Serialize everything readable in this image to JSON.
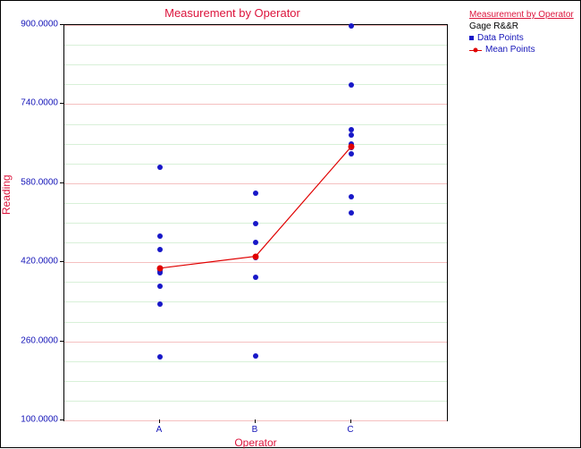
{
  "chart_data": {
    "type": "scatter",
    "title": "Measurement by Operator",
    "xlabel": "Operator",
    "ylabel": "Reading",
    "categories": [
      "A",
      "B",
      "C"
    ],
    "y_ticks": [
      100,
      260,
      420,
      580,
      740,
      900
    ],
    "y_tick_labels": [
      "100.0000",
      "260.0000",
      "420.0000",
      "580.0000",
      "740.0000",
      "900.0000"
    ],
    "ylim": [
      100,
      900
    ],
    "series": [
      {
        "name": "Data Points",
        "type": "scatter",
        "values": {
          "A": [
            228,
            335,
            372,
            398,
            402,
            446,
            472,
            612
          ],
          "B": [
            230,
            390,
            430,
            460,
            498,
            560
          ],
          "C": [
            520,
            552,
            640,
            652,
            660,
            678,
            688,
            778,
            898
          ]
        }
      },
      {
        "name": "Mean Points",
        "type": "line",
        "values": {
          "A": 408,
          "B": 432,
          "C": 654
        }
      }
    ],
    "legend": {
      "title": "Measurement by Operator",
      "subtitle": "Gage R&&R",
      "items": [
        "Data Points",
        "Mean Points"
      ]
    }
  }
}
